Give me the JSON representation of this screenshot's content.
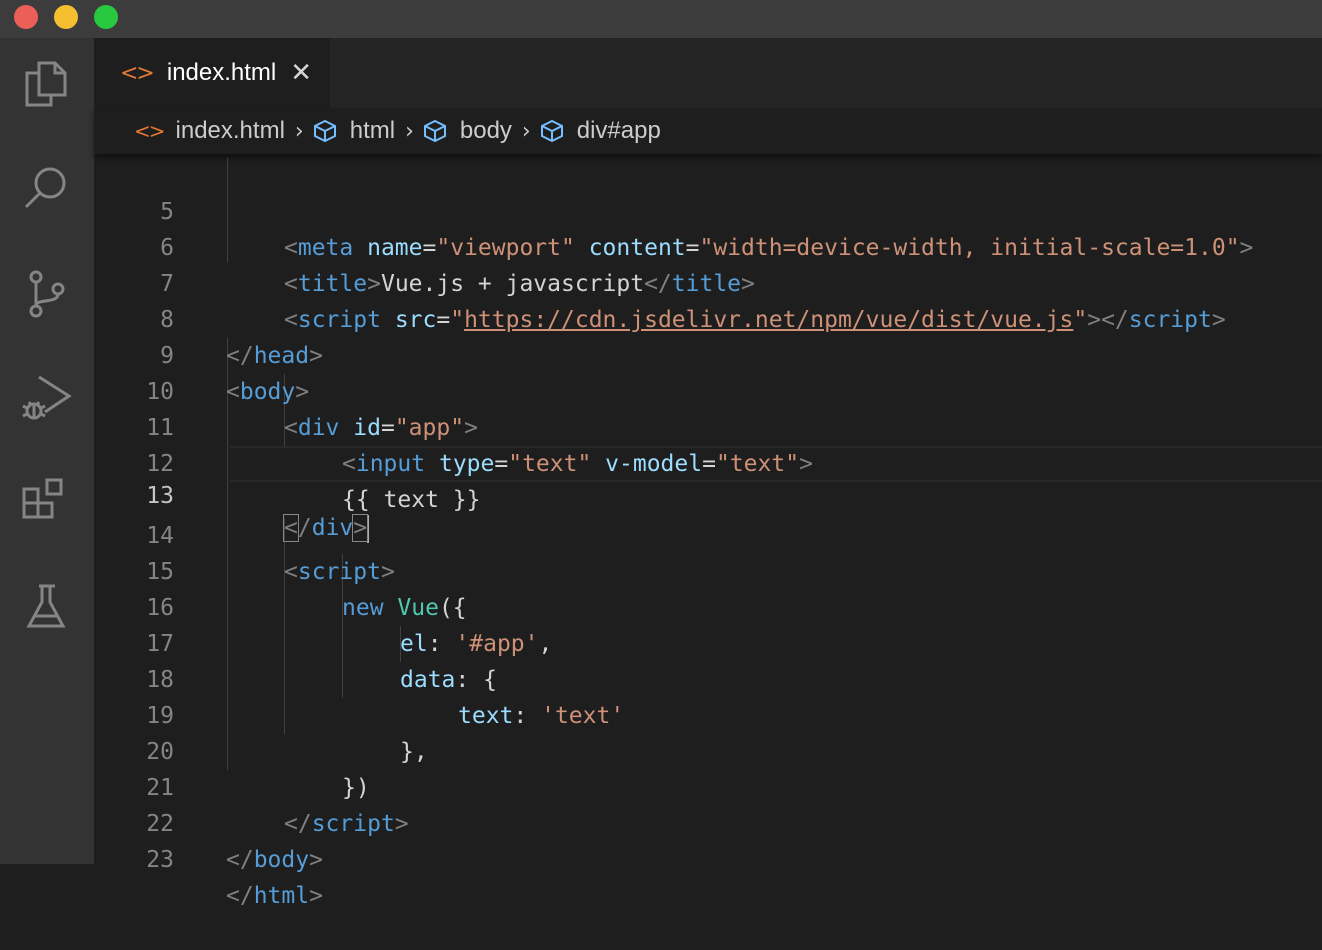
{
  "window": {
    "traffic_lights": [
      {
        "name": "close",
        "color": "#ec5f58"
      },
      {
        "name": "minimize",
        "color": "#f5bf2f"
      },
      {
        "name": "maximize",
        "color": "#28c83f"
      }
    ]
  },
  "activity_bar": {
    "icons": [
      "explorer-icon",
      "search-icon",
      "source-control-icon",
      "run-debug-icon",
      "extensions-icon",
      "testing-icon"
    ]
  },
  "tab": {
    "icon": "<>",
    "label": "index.html",
    "close": "✕"
  },
  "breadcrumbs": {
    "file_icon": "<>",
    "items": [
      "index.html",
      "html",
      "body",
      "div#app"
    ],
    "separator": "›"
  },
  "editor": {
    "current_line": 13,
    "lines": [
      {
        "n": "5"
      },
      {
        "n": "6"
      },
      {
        "n": "7"
      },
      {
        "n": "8"
      },
      {
        "n": "9"
      },
      {
        "n": "10"
      },
      {
        "n": "11"
      },
      {
        "n": "12"
      },
      {
        "n": "13"
      },
      {
        "n": "14"
      },
      {
        "n": "15"
      },
      {
        "n": "16"
      },
      {
        "n": "17"
      },
      {
        "n": "18"
      },
      {
        "n": "19"
      },
      {
        "n": "20"
      },
      {
        "n": "21"
      },
      {
        "n": "22"
      },
      {
        "n": "23"
      }
    ],
    "code": {
      "l5": {
        "lt": "<",
        "tag": "meta",
        "a1": "name",
        "eq": "=",
        "v1": "\"viewport\"",
        "a2": "content",
        "v2": "\"width=device-width, initial-scale=1.0\"",
        "gt": ">"
      },
      "l6": {
        "tag": "title",
        "text": "Vue.js + javascript"
      },
      "l7": {
        "tag": "script",
        "attr": "src",
        "q": "\"",
        "url": "https://cdn.jsdelivr.net/npm/vue/dist/vue.js"
      },
      "l8": {
        "tag": "head"
      },
      "l9": {
        "tag": "body"
      },
      "l10": {
        "tag": "div",
        "attr": "id",
        "val": "\"app\""
      },
      "l11": {
        "tag": "input",
        "a1": "type",
        "v1": "\"text\"",
        "a2": "v-model",
        "v2": "\"text\""
      },
      "l12": {
        "text": "{{ text }}"
      },
      "l13": {
        "tag": "div"
      },
      "l14": {
        "tag": "script"
      },
      "l15": {
        "kw": "new",
        "cls": "Vue",
        "rest": "({"
      },
      "l16": {
        "prop": "el",
        "colon": ": ",
        "str": "'#app'",
        "tail": ","
      },
      "l17": {
        "prop": "data",
        "colon": ": ",
        "tail": "{"
      },
      "l18": {
        "prop": "text",
        "colon": ": ",
        "str": "'text'"
      },
      "l19": {
        "text": "},"
      },
      "l20": {
        "text": "})"
      },
      "l21": {
        "tag": "script"
      },
      "l22": {
        "tag": "body"
      },
      "l23": {
        "tag": "html"
      }
    }
  },
  "colors": {
    "background": "#1e1e1e",
    "activity_bar": "#333333",
    "tag": "#569cd6",
    "attribute": "#9cdcfe",
    "string": "#ce9178",
    "class": "#4ec9b0",
    "punctuation": "#808080"
  }
}
